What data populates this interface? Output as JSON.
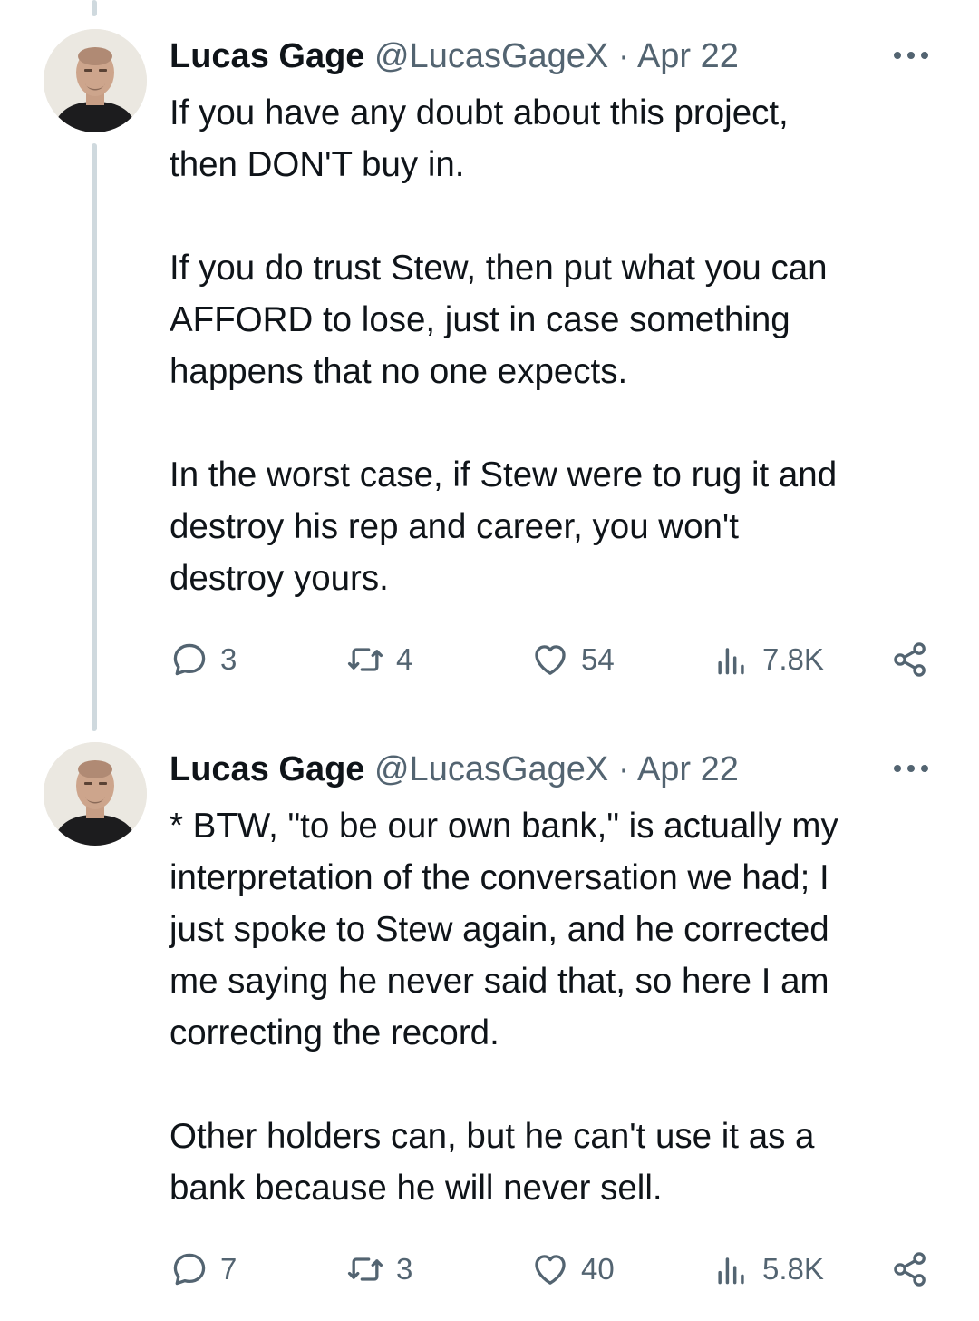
{
  "tweets": [
    {
      "author_name": "Lucas Gage",
      "handle": "@LucasGageX",
      "separator": "·",
      "date": "Apr 22",
      "paragraphs": [
        "If you have any doubt about this project,\nthen DON'T buy in.",
        "If you do trust Stew, then put what you can\nAFFORD to lose, just in case something\nhappens that no one expects.",
        "In the worst case, if Stew were to rug it and\ndestroy his rep and career, you won't\ndestroy yours."
      ],
      "replies": "3",
      "reposts": "4",
      "likes": "54",
      "views": "7.8K"
    },
    {
      "author_name": "Lucas Gage",
      "handle": "@LucasGageX",
      "separator": "·",
      "date": "Apr 22",
      "paragraphs": [
        "* BTW, \"to be our own bank,\" is actually my\ninterpretation of the conversation we had; I\njust spoke to Stew again, and he corrected\nme saying he never said that, so here I am\ncorrecting the record.",
        "Other holders can, but he can't use it as a\nbank because he will never sell."
      ],
      "replies": "7",
      "reposts": "3",
      "likes": "40",
      "views": "5.8K"
    }
  ],
  "icons": {
    "reply": "speech-bubble-icon",
    "repost": "repost-arrows-icon",
    "like": "heart-icon",
    "views": "bar-chart-icon",
    "share": "share-icon",
    "more": "ellipsis-icon"
  },
  "colors": {
    "text": "#0f1419",
    "secondary": "#536471",
    "thread_line": "#cfd9de",
    "background": "#ffffff"
  }
}
